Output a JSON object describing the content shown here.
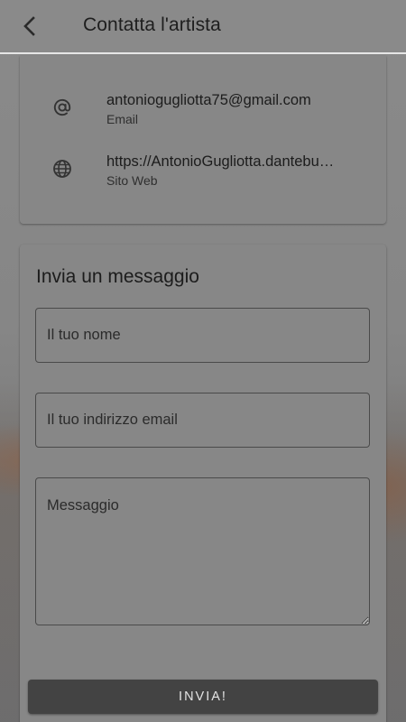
{
  "header": {
    "title": "Contatta l'artista",
    "back_icon": "chevron-left-icon"
  },
  "contacts": [
    {
      "icon": "at-sign-icon",
      "value": "antoniogugliotta75@gmail.com",
      "label": "Email"
    },
    {
      "icon": "globe-icon",
      "value": "https://AntonioGugliotta.dantebu…",
      "label": "Sito Web"
    }
  ],
  "form": {
    "title": "Invia un messaggio",
    "name_placeholder": "Il tuo nome",
    "email_placeholder": "Il tuo indirizzo email",
    "message_placeholder": "Messaggio",
    "submit_label": "INVIA!"
  },
  "colors": {
    "overlay_gray": "#878787",
    "button_dark": "#434343",
    "header_divider": "#e6e6e6"
  }
}
